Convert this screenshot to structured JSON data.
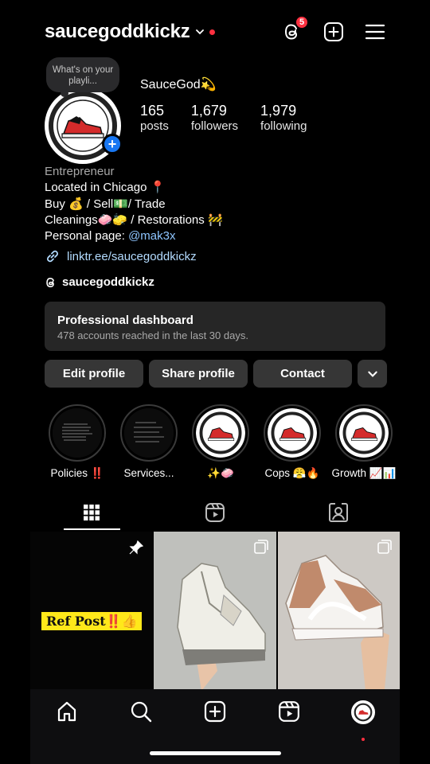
{
  "header": {
    "username": "saucegoddkickz",
    "threads_badge_count": "5"
  },
  "note": {
    "text": "What's on your playli..."
  },
  "profile": {
    "display_name": "SauceGod💫",
    "stats": [
      {
        "value": "165",
        "label": "posts"
      },
      {
        "value": "1,679",
        "label": "followers"
      },
      {
        "value": "1,979",
        "label": "following"
      }
    ]
  },
  "bio": {
    "category": "Entrepreneur",
    "lines": [
      "Located in Chicago 📍",
      "Buy 💰 / Sell💵/ Trade",
      "Cleanings🧼🧽 / Restorations 🚧"
    ],
    "personal_prefix": "Personal page: ",
    "personal_handle": "@mak3x",
    "link": "linktr.ee/saucegoddkickz",
    "threads_handle": "saucegoddkickz"
  },
  "dashboard": {
    "title": "Professional dashboard",
    "subtitle": "478 accounts reached in the last 30 days."
  },
  "actions": {
    "edit": "Edit profile",
    "share": "Share profile",
    "contact": "Contact"
  },
  "highlights": [
    {
      "label": "Policies ‼️"
    },
    {
      "label": "Services..."
    },
    {
      "label": "✨🧼"
    },
    {
      "label": "Cops 😤🔥"
    },
    {
      "label": "Growth 📈📊"
    }
  ],
  "posts": {
    "ref_post_text": "Ref Post‼️👍"
  },
  "icons": {
    "header": [
      "chevron-down-icon",
      "threads-icon",
      "new-post-icon",
      "menu-icon"
    ],
    "tabs": [
      "grid-icon",
      "reels-icon",
      "tagged-icon"
    ],
    "nav": [
      "home-icon",
      "search-icon",
      "create-icon",
      "reels-icon",
      "profile-avatar"
    ]
  },
  "colors": {
    "accent_red": "#ff3040",
    "blue": "#1877f2",
    "link": "#b3dbff",
    "button_bg": "#363636"
  }
}
